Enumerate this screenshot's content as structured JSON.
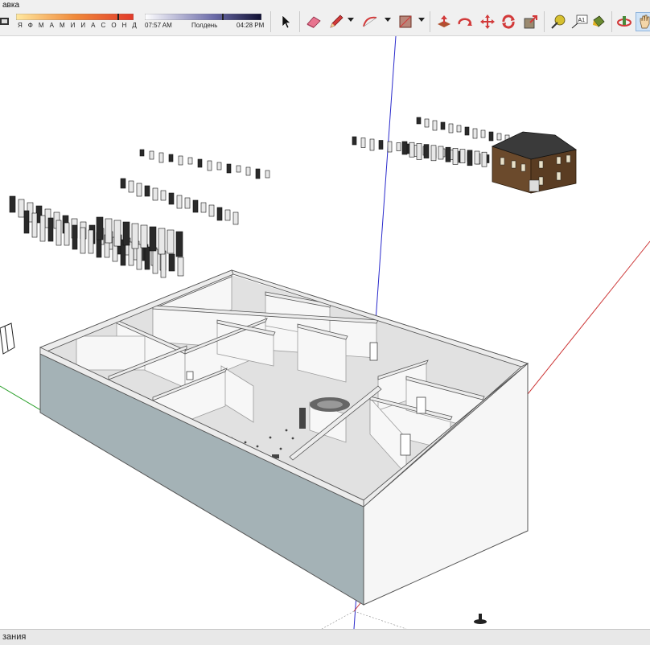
{
  "app": {
    "menu_fragment": "авка"
  },
  "toolbar": {
    "shadow_months": "Я Ф М А М И И А С О Н Д",
    "time_start": "07:57 AM",
    "time_mid": "Полдень",
    "time_end": "04:28 PM",
    "tools": [
      {
        "name": "select-tool",
        "icon": "arrow-icon"
      },
      {
        "name": "eraser-tool",
        "icon": "eraser-icon"
      },
      {
        "name": "line-tool",
        "icon": "pencil-icon"
      },
      {
        "name": "arc-tool",
        "icon": "arc-icon"
      },
      {
        "name": "rectangle-tool",
        "icon": "rectangle-icon"
      },
      {
        "name": "push-pull-tool",
        "icon": "push-pull-icon"
      },
      {
        "name": "rotate-tool",
        "icon": "rotate-icon"
      },
      {
        "name": "move-tool",
        "icon": "move-icon"
      },
      {
        "name": "follow-me-tool",
        "icon": "follow-me-icon"
      },
      {
        "name": "scale-tool",
        "icon": "scale-icon"
      },
      {
        "name": "tape-measure-tool",
        "icon": "tape-measure-icon"
      },
      {
        "name": "text-tool",
        "icon": "text-icon"
      },
      {
        "name": "paint-bucket-tool",
        "icon": "paint-bucket-icon"
      },
      {
        "name": "orbit-tool",
        "icon": "orbit-icon"
      },
      {
        "name": "pan-tool",
        "icon": "pan-icon"
      }
    ],
    "text_tool_glyph": "A1"
  },
  "colors": {
    "wall_top": "#ececec",
    "wall_side_left": "#a4b2b6",
    "wall_side_front": "#f6f6f6",
    "floor": "#e0e0e0",
    "axis_blue": "#2a2acc",
    "axis_red": "#cc3333",
    "axis_green": "#2aa02a",
    "house_wall": "#6b4a2c",
    "house_roof": "#3a3a3a"
  },
  "status": {
    "text": "зания"
  }
}
